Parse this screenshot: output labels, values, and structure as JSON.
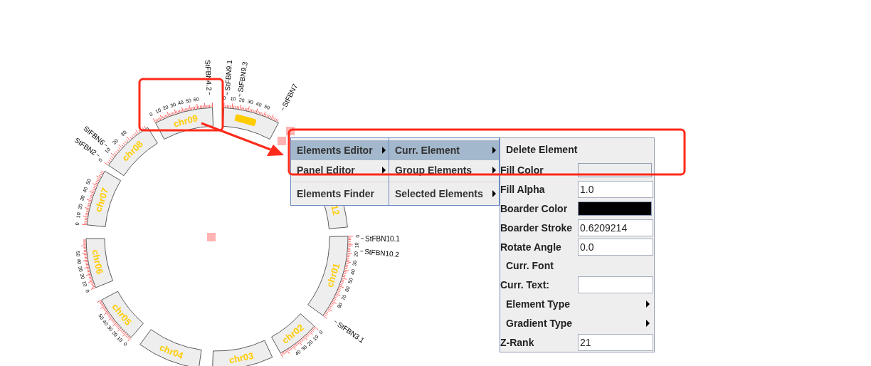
{
  "plot": {
    "segments": [
      {
        "kind": "label",
        "label": "chr01",
        "tick_labels": [
          "0",
          "10",
          "20",
          "30",
          "40",
          "50",
          "60",
          "70",
          "80"
        ],
        "genes_at_start": [
          "StFBN10.1",
          "StFBN10.2"
        ],
        "genes_at_end": [
          "StFBN3.1"
        ]
      },
      {
        "kind": "label",
        "label": "chr02",
        "tick_labels": [
          "0",
          "10",
          "20",
          "30",
          "40"
        ]
      },
      {
        "kind": "label",
        "label": "chr03"
      },
      {
        "kind": "label",
        "label": "chr04"
      },
      {
        "kind": "label",
        "label": "chr05",
        "tick_labels": [
          "0",
          "10",
          "20",
          "30",
          "40",
          "50"
        ]
      },
      {
        "kind": "label",
        "label": "chr06",
        "tick_labels": [
          "0",
          "10",
          "20",
          "30",
          "40",
          "50"
        ]
      },
      {
        "kind": "label",
        "label": "chr07",
        "tick_labels": [
          "0",
          "10",
          "20",
          "30",
          "40",
          "50"
        ]
      },
      {
        "kind": "label",
        "label": "chr08",
        "tick_labels": [
          "0",
          "10",
          "20",
          "30"
        ],
        "genes_at_start": [
          "StFBN2",
          "StFBN6"
        ]
      },
      {
        "kind": "label",
        "label": "chr09",
        "tick_labels": [
          "0",
          "10",
          "20",
          "30",
          "40",
          "50",
          "60"
        ],
        "genes_at_end": [
          "StFBN4.2"
        ]
      },
      {
        "kind": "bar",
        "tick_labels": [
          "0",
          "10",
          "20",
          "30",
          "40",
          "50"
        ],
        "genes_at_start": [
          "StFBN9.1",
          "StFBN9.3"
        ],
        "genes_at_end": [
          "StFBN7"
        ]
      },
      {
        "kind": "label",
        "label": "12"
      }
    ]
  },
  "menus": [
    {
      "items": [
        {
          "label": "Elements Editor",
          "selected": true,
          "submenu": true
        },
        {
          "label": "Panel Editor",
          "selected": false,
          "submenu": true
        },
        {
          "label": "Elements Finder",
          "selected": false,
          "submenu": false
        }
      ]
    },
    {
      "items": [
        {
          "label": "Curr. Element",
          "selected": true,
          "submenu": true
        },
        {
          "label": "Group Elements",
          "selected": false,
          "submenu": true
        },
        {
          "label": "Selected Elements",
          "selected": false,
          "submenu": true
        }
      ]
    }
  ],
  "properties": [
    {
      "kind": "action",
      "label": "Delete Element"
    },
    {
      "kind": "color",
      "label": "Fill Color",
      "color": "#eeeeee"
    },
    {
      "kind": "field",
      "label": "Fill Alpha",
      "value": "1.0"
    },
    {
      "kind": "color",
      "label": "Boarder Color",
      "color": "#000000"
    },
    {
      "kind": "field",
      "label": "Boarder Stroke",
      "value": "0.6209214"
    },
    {
      "kind": "field",
      "label": "Rotate Angle",
      "value": "0.0"
    },
    {
      "kind": "action",
      "label": "Curr. Font"
    },
    {
      "kind": "field",
      "label": "Curr. Text:"
    },
    {
      "kind": "submenu",
      "label": "Element Type"
    },
    {
      "kind": "submenu",
      "label": "Gradient Type"
    },
    {
      "kind": "field",
      "label": "Z-Rank",
      "value": "21"
    }
  ]
}
